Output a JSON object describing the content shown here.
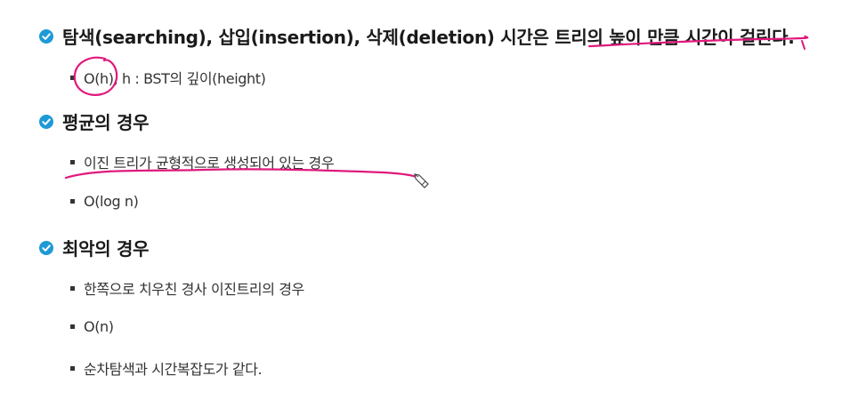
{
  "sections": [
    {
      "title": "탐색(searching), 삽입(insertion), 삭제(deletion) 시간은 트리의 높이 만큼 시간이 걸린다.",
      "bullets": [
        "O(h), h : BST의 깊이(height)"
      ]
    },
    {
      "title": "평균의 경우",
      "bullets": [
        "이진 트리가 균형적으로 생성되어 있는 경우",
        "O(log n)"
      ]
    },
    {
      "title": "최악의 경우",
      "bullets": [
        "한쪽으로 치우친 경사 이진트리의 경우",
        "O(n)",
        "순차탐색과 시간복잡도가 같다."
      ]
    }
  ],
  "colors": {
    "check_icon": "#1e9ad6",
    "annotation_ink": "#e0197d",
    "text": "#222222"
  },
  "icons": {
    "heading_marker": "check-circle-icon",
    "bullet_marker": "square-bullet-icon",
    "cursor": "pen-cursor-icon"
  }
}
